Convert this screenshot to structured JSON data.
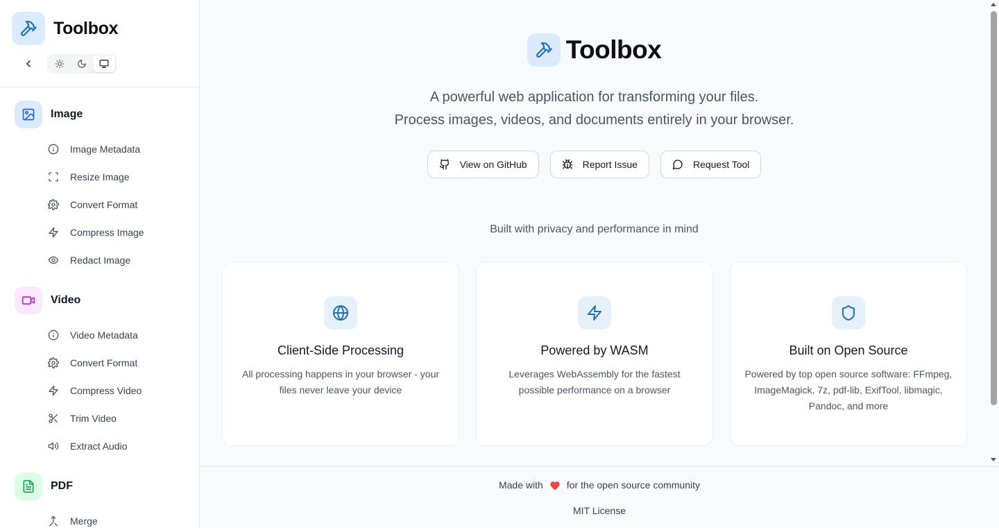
{
  "sidebar": {
    "brand_title": "Toolbox",
    "theme_options": [
      "light",
      "dark",
      "system"
    ],
    "theme_selected": "system",
    "sections": [
      {
        "label": "Image",
        "icon": "image-icon",
        "color": "#2563eb",
        "bg": "#dbeafe",
        "items": [
          {
            "label": "Image Metadata",
            "icon": "info-icon"
          },
          {
            "label": "Resize Image",
            "icon": "scan-icon"
          },
          {
            "label": "Convert Format",
            "icon": "gear-icon"
          },
          {
            "label": "Compress Image",
            "icon": "lightning-icon"
          },
          {
            "label": "Redact Image",
            "icon": "eye-icon"
          }
        ]
      },
      {
        "label": "Video",
        "icon": "video-icon",
        "color": "#c026d3",
        "bg": "#fae8ff",
        "items": [
          {
            "label": "Video Metadata",
            "icon": "info-icon"
          },
          {
            "label": "Convert Format",
            "icon": "gear-icon"
          },
          {
            "label": "Compress Video",
            "icon": "lightning-icon"
          },
          {
            "label": "Trim Video",
            "icon": "scissors-icon"
          },
          {
            "label": "Extract Audio",
            "icon": "speaker-icon"
          }
        ]
      },
      {
        "label": "PDF",
        "icon": "file-text-icon",
        "color": "#16a34a",
        "bg": "#dcfce7",
        "items": [
          {
            "label": "Merge",
            "icon": "merge-icon"
          }
        ]
      }
    ]
  },
  "hero": {
    "title": "Toolbox",
    "subtitle_line1": "A powerful web application for transforming your files.",
    "subtitle_line2": "Process images, videos, and documents entirely in your browser.",
    "actions": [
      {
        "label": "View on GitHub",
        "icon": "github-icon"
      },
      {
        "label": "Report Issue",
        "icon": "bug-icon"
      },
      {
        "label": "Request Tool",
        "icon": "message-icon"
      }
    ]
  },
  "features": {
    "tagline": "Built with privacy and performance in mind",
    "cards": [
      {
        "title": "Client-Side Processing",
        "desc": "All processing happens in your browser - your files never leave your device",
        "icon": "globe-icon"
      },
      {
        "title": "Powered by WASM",
        "desc": "Leverages WebAssembly for the fastest possible performance on a browser",
        "icon": "lightning-icon"
      },
      {
        "title": "Built on Open Source",
        "desc": "Powered by top open source software: FFmpeg, ImageMagick, 7z, pdf-lib, ExifTool, libmagic, Pandoc, and more",
        "icon": "shield-icon"
      }
    ]
  },
  "footer": {
    "made_with_prefix": "Made with",
    "made_with_suffix": "for the open source community",
    "license": "MIT License",
    "heart_color": "#ef4444"
  },
  "colors": {
    "accent": "#1d6fb8",
    "icon_gray": "#4b5563"
  }
}
